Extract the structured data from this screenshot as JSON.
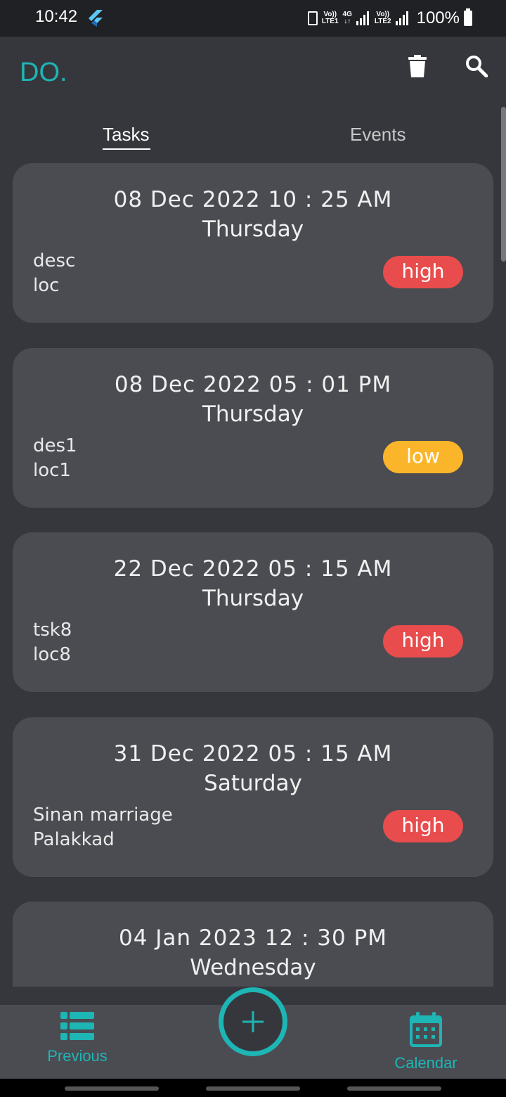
{
  "status_bar": {
    "time": "10:42",
    "sim1_label_top": "Vo))",
    "sim1_label_bottom": "LTE1",
    "network": "4G",
    "sim2_label_top": "Vo))",
    "sim2_label_bottom": "LTE2",
    "battery": "100%"
  },
  "header": {
    "logo": "DO.",
    "delete_icon": "trash-icon",
    "search_icon": "search-icon"
  },
  "tabs": [
    {
      "label": "Tasks",
      "active": true
    },
    {
      "label": "Events",
      "active": false
    }
  ],
  "tasks": [
    {
      "date": "08 Dec 2022 10 : 25 AM",
      "day": "Thursday",
      "desc": "desc",
      "loc": "loc",
      "priority": "high",
      "priority_color": "#e84c4d"
    },
    {
      "date": "08 Dec 2022 05 : 01 PM",
      "day": "Thursday",
      "desc": "des1",
      "loc": "loc1",
      "priority": "low",
      "priority_color": "#fbb52a"
    },
    {
      "date": "22 Dec 2022 05 : 15 AM",
      "day": "Thursday",
      "desc": "tsk8",
      "loc": "loc8",
      "priority": "high",
      "priority_color": "#e84c4d"
    },
    {
      "date": "31 Dec 2022 05 : 15 AM",
      "day": "Saturday",
      "desc": "Sinan marriage",
      "loc": "Palakkad",
      "priority": "high",
      "priority_color": "#e84c4d"
    },
    {
      "date": "04 Jan 2023 12 : 30 PM",
      "day": "Wednesday",
      "desc": "",
      "loc": "",
      "priority": "",
      "priority_color": "#e84c4d"
    }
  ],
  "bottom_nav": {
    "previous": {
      "label": "Previous",
      "icon": "list-icon"
    },
    "add": {
      "icon": "plus-icon"
    },
    "calendar": {
      "label": "Calendar",
      "icon": "calendar-icon"
    }
  },
  "colors": {
    "accent": "#1eb5b5",
    "background": "#36373c",
    "card": "#4b4c52",
    "high": "#e84c4d",
    "low": "#fbb52a"
  }
}
